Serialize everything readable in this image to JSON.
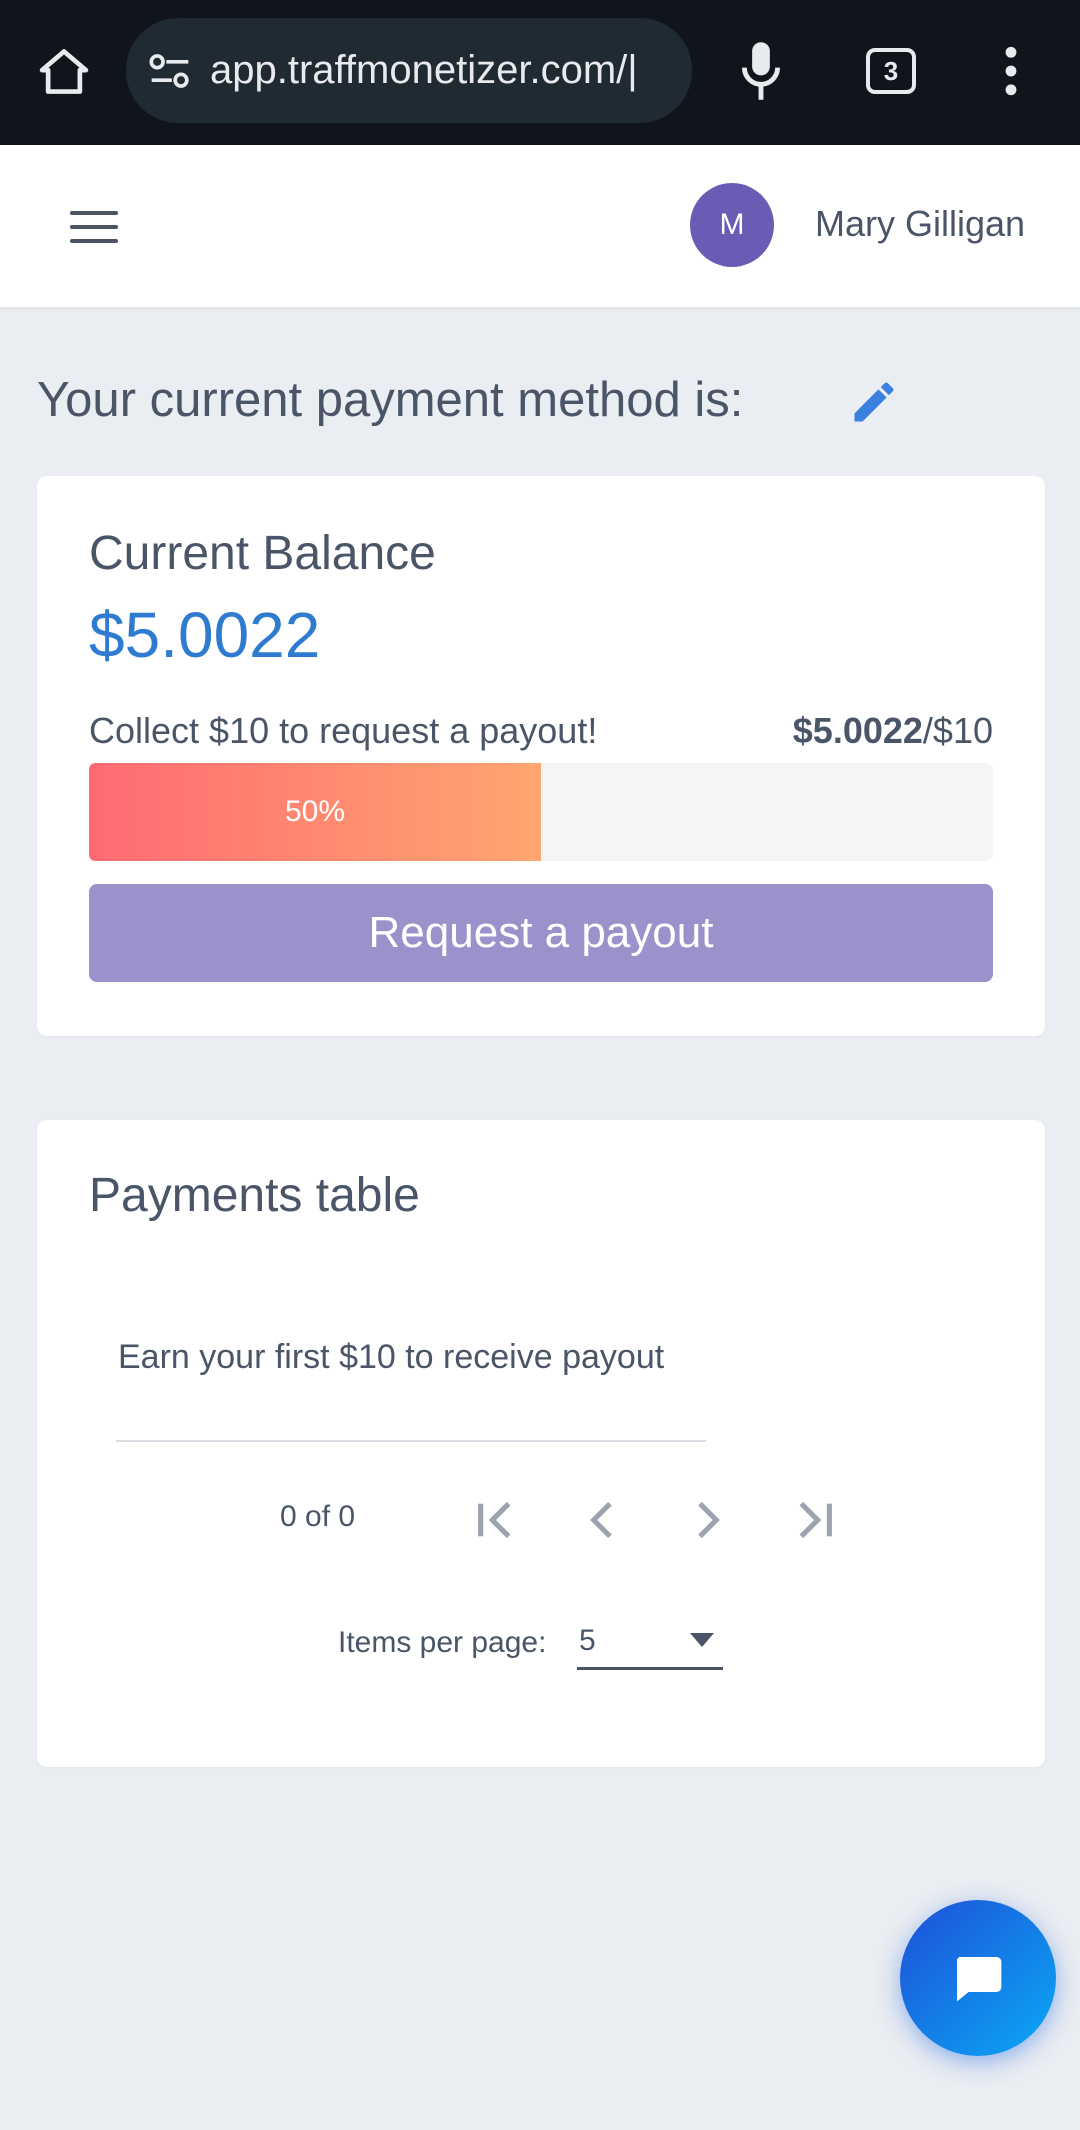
{
  "browser": {
    "url": "app.traffmonetizer.com/|",
    "tab_count": "3",
    "icons": [
      "home-icon",
      "tune-icon",
      "mic-icon",
      "more-vert-icon"
    ]
  },
  "header": {
    "avatar_initial": "M",
    "user_name": "Mary Gilligan",
    "icons": [
      "menu-icon"
    ]
  },
  "payment_method": {
    "heading": "Your current payment method is:",
    "icon": "pencil-icon",
    "icon_color": "#3b82e0"
  },
  "balance": {
    "label": "Current Balance",
    "amount": "$5.0022",
    "collect_text": "Collect $10 to request a payout!",
    "progress_current": "$5.0022",
    "progress_target": "/$10",
    "progress_fraction": 0.5,
    "progress_label": "50%",
    "payout_button": "Request a payout",
    "colors": {
      "amount": "#2f7bd0",
      "button": "#9d91cb",
      "progress_start": "#ff6a72",
      "progress_end": "#ffa66f"
    }
  },
  "payments": {
    "title": "Payments table",
    "empty_message": "Earn your first $10 to receive payout",
    "range_label": "0 of 0",
    "items_per_page_label": "Items per page:",
    "items_per_page_value": "5",
    "icons": [
      "first-page-icon",
      "chevron-left-icon",
      "chevron-right-icon",
      "last-page-icon",
      "dropdown-caret-icon"
    ]
  },
  "chat": {
    "icon": "chat-bubble-icon",
    "colors": {
      "start": "#1e4fd8",
      "end": "#0aa9f5"
    }
  }
}
